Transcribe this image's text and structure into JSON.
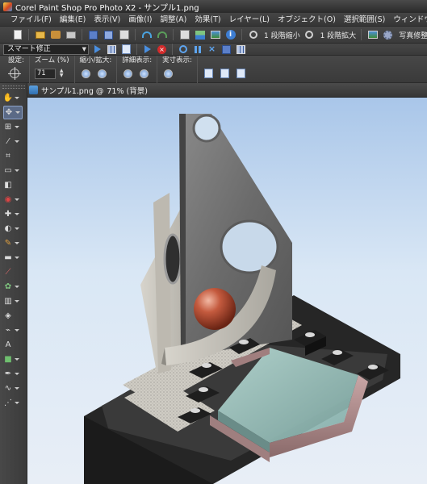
{
  "window": {
    "title": "Corel Paint Shop Pro Photo X2 - サンプル1.png"
  },
  "menubar": {
    "items": [
      {
        "label": "ファイル(F)"
      },
      {
        "label": "編集(E)"
      },
      {
        "label": "表示(V)"
      },
      {
        "label": "画像(I)"
      },
      {
        "label": "調整(A)"
      },
      {
        "label": "効果(T)"
      },
      {
        "label": "レイヤー(L)"
      },
      {
        "label": "オブジェクト(O)"
      },
      {
        "label": "選択範囲(S)"
      },
      {
        "label": "ウィンドウ(W)"
      }
    ]
  },
  "toolbar": {
    "zoom_out_label": "1 段階縮小",
    "zoom_in_label": "1 段階拡大",
    "photo_fix_label": "写真修整(N)"
  },
  "script_bar": {
    "script_select_value": "スマート修正"
  },
  "options": {
    "settings_label": "設定:",
    "zoom_label": "ズーム (%)",
    "zoom_value": "71",
    "zoom_inout_label": "縮小/拡大:",
    "details_label": "詳細表示:",
    "actual_label": "実寸表示:"
  },
  "document": {
    "title": "サンプル1.png @",
    "zoom_text": "71% (背景)"
  },
  "colors": {
    "app_bg": "#3d3d3d",
    "accent_blue": "#4a8fe0",
    "canvas_sky_top": "#a9c6e9",
    "canvas_sky_bottom": "#e8eef6"
  }
}
